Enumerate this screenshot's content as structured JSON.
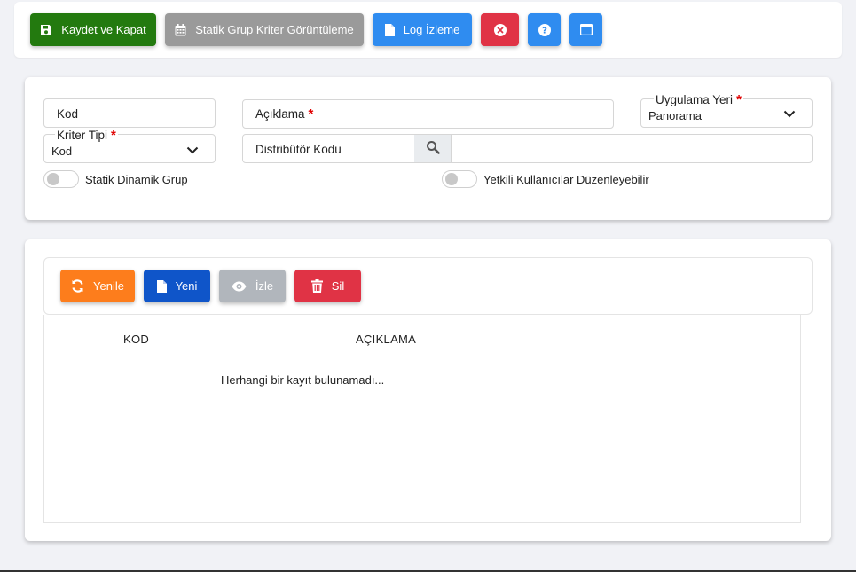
{
  "toolbar": {
    "save_close_label": "Kaydet ve Kapat",
    "static_group_label": "Statik Grup Kriter Görüntüleme",
    "log_label": "Log İzleme"
  },
  "form": {
    "kod_label": "Kod",
    "aciklama_label": "Açıklama",
    "uygulama_yeri_label": "Uygulama Yeri",
    "uygulama_yeri_value": "Panorama",
    "kriter_tipi_label": "Kriter Tipi",
    "kriter_tipi_value": "Kod",
    "distributor_label": "Distribütör Kodu",
    "required_mark": "*",
    "toggle_static_label": "Statik Dinamik Grup",
    "toggle_auth_label": "Yetkili Kullanıcılar Düzenleyebilir"
  },
  "grid": {
    "refresh_label": "Yenile",
    "new_label": "Yeni",
    "view_label": "İzle",
    "delete_label": "Sil",
    "columns": [
      "KOD",
      "AÇIKLAMA"
    ],
    "empty_message": "Herhangi bir kayıt bulunamadı..."
  },
  "colors": {
    "green": "#237a0f",
    "gray": "#9a9a9a",
    "blue": "#2f8cf0",
    "red": "#e03345",
    "orange": "#fd7d1c",
    "navy": "#0f55c9",
    "required": "#e00000"
  },
  "icons": {
    "save": "floppy-disk-icon",
    "calendar": "calendar-icon",
    "file": "file-icon",
    "close": "times-circle-icon",
    "help": "question-circle-icon",
    "window": "window-icon",
    "search": "search-icon",
    "refresh": "sync-icon",
    "eye": "eye-icon",
    "trash": "trash-icon",
    "chevron": "chevron-down-icon"
  }
}
